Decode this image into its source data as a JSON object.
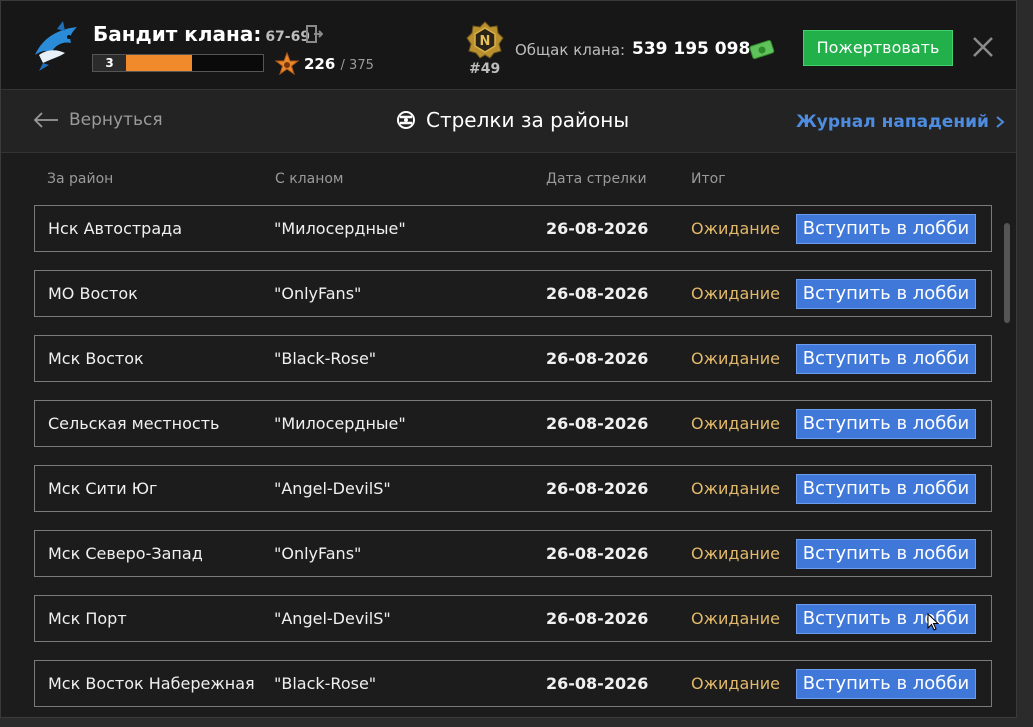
{
  "header": {
    "rank_title": "Бандит клана:",
    "rank_range": "67-69",
    "level": "3",
    "level_progress": 0.48,
    "reputation": "226",
    "reputation_max": "/ 375",
    "clan_rank": "#49",
    "clan_badge_letter": "N",
    "bank_label": "Общак клана:",
    "bank_value": "539 195 098",
    "donate_label": "Пожертвовать"
  },
  "nav": {
    "back_label": "Вернуться",
    "title": "Стрелки за районы",
    "log_link": "Журнал нападений"
  },
  "table": {
    "headers": [
      "За район",
      "С кланом",
      "Дата стрелки",
      "Итог"
    ],
    "rows": [
      {
        "district": "Нск Автострада",
        "clan": "\"Милосердные\"",
        "date": "26-08-2026",
        "result": "Ожидание",
        "action": "Вступить в лобби"
      },
      {
        "district": "МО Восток",
        "clan": "\"OnlyFans\"",
        "date": "26-08-2026",
        "result": "Ожидание",
        "action": "Вступить в лобби"
      },
      {
        "district": "Мск Восток",
        "clan": "\"Black-Rose\"",
        "date": "26-08-2026",
        "result": "Ожидание",
        "action": "Вступить в лобби"
      },
      {
        "district": "Сельская местность",
        "clan": "\"Милосердные\"",
        "date": "26-08-2026",
        "result": "Ожидание",
        "action": "Вступить в лобби"
      },
      {
        "district": "Мск Сити Юг",
        "clan": "\"Angel-DevilS\"",
        "date": "26-08-2026",
        "result": "Ожидание",
        "action": "Вступить в лобби"
      },
      {
        "district": "Мск Северо-Запад",
        "clan": "\"OnlyFans\"",
        "date": "26-08-2026",
        "result": "Ожидание",
        "action": "Вступить в лобби"
      },
      {
        "district": "Мск Порт",
        "clan": "\"Angel-DevilS\"",
        "date": "26-08-2026",
        "result": "Ожидание",
        "action": "Вступить в лобби"
      },
      {
        "district": "Мск Восток Набережная",
        "clan": "\"Black-Rose\"",
        "date": "26-08-2026",
        "result": "Ожидание",
        "action": "Вступить в лобби"
      }
    ]
  },
  "colors": {
    "accent_blue": "#3f78d8",
    "donate_green": "#21b04a",
    "pending_yellow": "#e2b96a",
    "level_orange": "#f08a2a"
  }
}
